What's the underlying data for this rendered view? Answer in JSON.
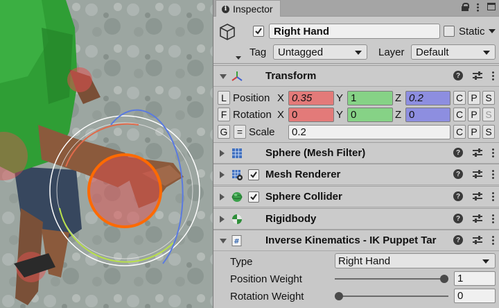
{
  "inspector": {
    "tab_label": "Inspector",
    "game_object": {
      "active": true,
      "name": "Right Hand",
      "static_label": "Static",
      "static": false,
      "tag_label": "Tag",
      "tag_value": "Untagged",
      "layer_label": "Layer",
      "layer_value": "Default"
    },
    "transform": {
      "title": "Transform",
      "position": {
        "btn": "L",
        "label": "Position",
        "x": "0.35",
        "y": "1",
        "z": "0.2"
      },
      "rotation": {
        "btn": "F",
        "label": "Rotation",
        "x": "0",
        "y": "0",
        "z": "0"
      },
      "scale": {
        "btn": "G",
        "eq": "=",
        "label": "Scale",
        "value": "0.2"
      },
      "axes": {
        "x": "X",
        "y": "Y",
        "z": "Z"
      },
      "cps": {
        "c": "C",
        "p": "P",
        "s": "S"
      }
    },
    "components": [
      {
        "title": "Sphere (Mesh Filter)"
      },
      {
        "title": "Mesh Renderer",
        "enabled": true
      },
      {
        "title": "Sphere Collider",
        "enabled": true
      },
      {
        "title": "Rigidbody"
      },
      {
        "title": "Inverse Kinematics - IK Puppet Tar"
      }
    ],
    "ik": {
      "type_label": "Type",
      "type_value": "Right Hand",
      "position_weight_label": "Position Weight",
      "position_weight": "1",
      "position_weight_fraction": 1,
      "rotation_weight_label": "Rotation Weight",
      "rotation_weight": "0",
      "rotation_weight_fraction": 0
    },
    "help_glyph": "?"
  },
  "colors": {
    "x_field": "#e37a79",
    "y_field": "#86d286",
    "z_field": "#8d8ee0",
    "gizmo_orange": "#ff6a00",
    "character_shirt": "#2f9e35",
    "character_skin": "#8b5a3c"
  },
  "icons": {
    "game_object": "cube-icon",
    "transform": "transform-axes-icon",
    "mesh_filter": "mesh-grid-icon",
    "mesh_renderer": "mesh-renderer-icon",
    "collider": "sphere-collider-icon",
    "rigidbody": "rigidbody-icon",
    "script": "script-icon"
  }
}
